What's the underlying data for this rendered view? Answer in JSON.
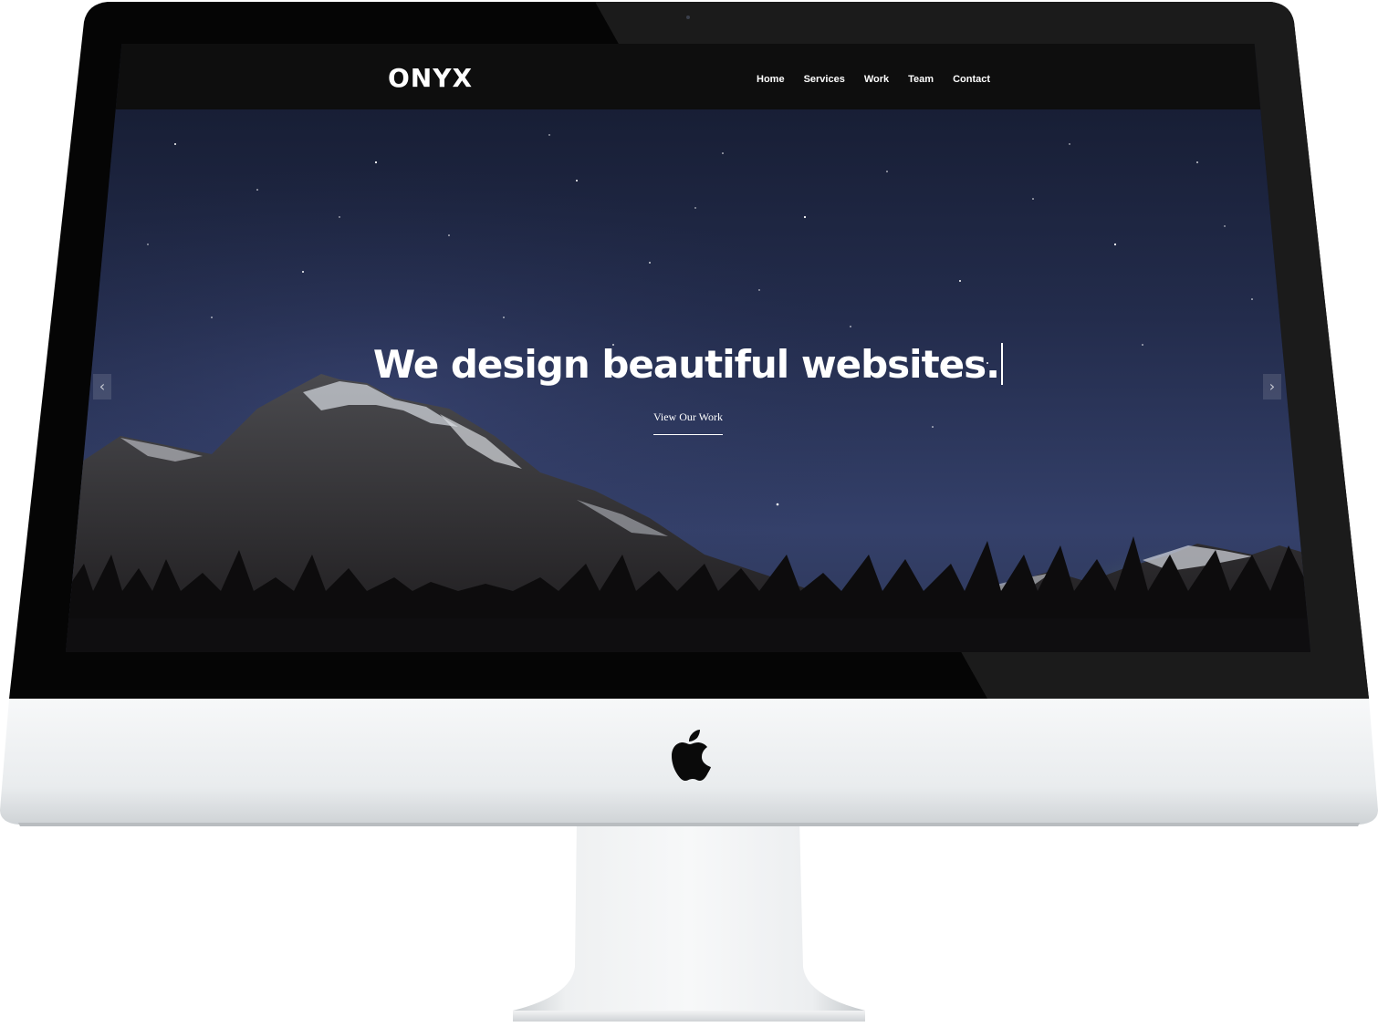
{
  "site": {
    "brand": "ONYX",
    "nav": [
      {
        "label": "Home"
      },
      {
        "label": "Services"
      },
      {
        "label": "Work"
      },
      {
        "label": "Team"
      },
      {
        "label": "Contact"
      }
    ],
    "hero": {
      "headline": "We design beautiful websites.",
      "cta_label": "View Our Work",
      "prev_arrow": "‹",
      "next_arrow": "›"
    }
  },
  "icons": {
    "device_logo": "apple-logo-icon",
    "prev": "chevron-left-icon",
    "next": "chevron-right-icon"
  },
  "colors": {
    "navbar_bg": "#0e0e0e",
    "sky_top": "#141a2e",
    "sky_mid": "#2a3458",
    "aurora": "#6f9a63",
    "monitor_frame": "#0a0a0a",
    "monitor_chin": "#eceff1",
    "text": "#ffffff"
  }
}
